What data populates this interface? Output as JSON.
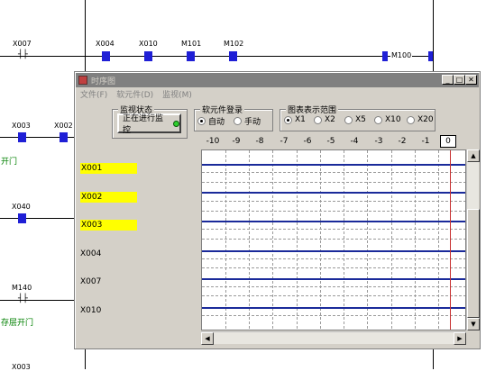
{
  "ladder": {
    "top_labels": [
      "X007",
      "X004",
      "X010",
      "M101",
      "M102",
      "M100"
    ],
    "left_labels": [
      "X003",
      "X002",
      "X040",
      "M140",
      "X003"
    ],
    "comments": [
      "开门",
      "存层开门"
    ]
  },
  "window": {
    "title": "时序图",
    "menu": [
      "文件(F)",
      "软元件(D)",
      "监视(M)"
    ],
    "monitor_group": "监视状态",
    "monitor_button": "正在进行监控",
    "device_group": "软元件登录",
    "device_options": [
      "自动",
      "手动"
    ],
    "device_selected": "自动",
    "range_group": "图表表示范围",
    "range_options": [
      "X1",
      "X2",
      "X5",
      "X10",
      "X20"
    ],
    "range_selected": "X1",
    "ticks": [
      "-10",
      "-9",
      "-8",
      "-7",
      "-6",
      "-5",
      "-4",
      "-3",
      "-2",
      "-1",
      "0"
    ],
    "rows": [
      {
        "label": "X001",
        "highlight": true
      },
      {
        "label": "X002",
        "highlight": true
      },
      {
        "label": "X003",
        "highlight": true
      },
      {
        "label": "X004",
        "highlight": false
      },
      {
        "label": "X007",
        "highlight": false
      },
      {
        "label": "X010",
        "highlight": false
      }
    ],
    "colors": {
      "signal": "#1a2a9a",
      "cursor": "#c83030",
      "highlight": "#ffff00"
    }
  }
}
